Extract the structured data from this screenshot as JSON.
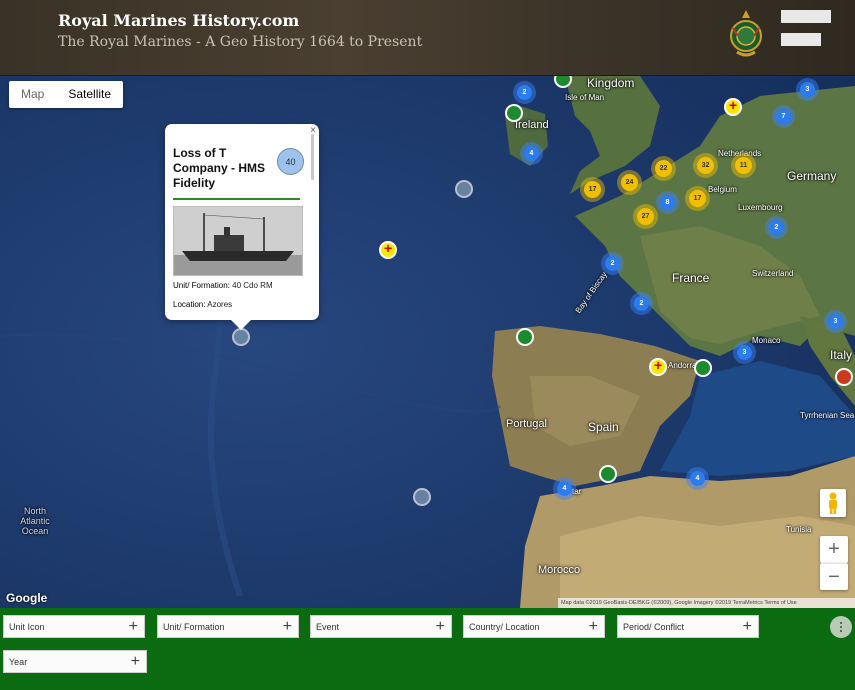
{
  "header": {
    "site_title": "Royal Marines History.com",
    "site_subtitle": "The Royal Marines - A Geo History 1664 to Present"
  },
  "map": {
    "type_control": {
      "map_label": "Map",
      "satellite_label": "Satellite",
      "selected": "Satellite"
    },
    "labels": {
      "kingdom": "Kingdom",
      "isle_of_man": "Isle of Man",
      "ireland": "Ireland",
      "netherlands": "Netherlands",
      "germany": "Germany",
      "belgium": "Belgium",
      "luxembourg": "Luxembourg",
      "france": "France",
      "switzerland": "Switzerland",
      "monaco": "Monaco",
      "italy": "Italy",
      "andorra": "Andorra",
      "portugal": "Portugal",
      "spain": "Spain",
      "tyrrhenian": "Tyrrhenian Sea",
      "gibraltar": "tar",
      "tunisia": "Tunisia",
      "morocco": "Morocco",
      "bay_biscay": "Bay of Biscay",
      "ocean": "North Atlantic Ocean"
    },
    "clusters": {
      "c1": "2",
      "c2": "4",
      "c3": "3",
      "c4": "7",
      "c5": "22",
      "c6": "32",
      "c7": "11",
      "c8": "17",
      "c9": "24",
      "c10": "8",
      "c11": "17",
      "c12": "27",
      "c13": "2",
      "c14": "2",
      "c15": "2",
      "c16": "3",
      "c17": "3",
      "c18": "4",
      "c19": "4"
    },
    "popup": {
      "title": "Loss of T Company - HMS Fidelity",
      "badge": "40",
      "close": "×",
      "unit_label": "Unit/ Formation:",
      "unit_value": "40 Cdo RM",
      "location_label": "Location:",
      "location_value": "Azores"
    },
    "zoom_in": "+",
    "zoom_out": "−",
    "google": "Google",
    "attribution": "Map data ©2019 GeoBasis-DE/BKG (©2009), Google Imagery ©2019 TerraMetrics   Terms of Use"
  },
  "filters": [
    {
      "label": "Unit Icon"
    },
    {
      "label": "Unit/ Formation"
    },
    {
      "label": "Event"
    },
    {
      "label": "Country/ Location"
    },
    {
      "label": "Period/ Conflict"
    },
    {
      "label": "Year"
    }
  ],
  "filter_plus": "+",
  "colors": {
    "header_bg": "#3f362a",
    "filter_bar": "#0b6b10",
    "cluster_blue": "#2a7cf0",
    "cluster_yellow": "#f0c000"
  }
}
